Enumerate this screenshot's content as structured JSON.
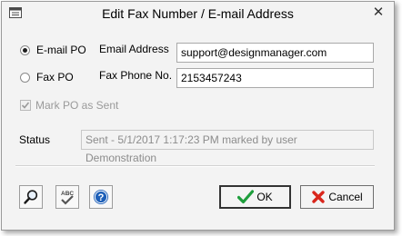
{
  "window": {
    "title": "Edit Fax Number / E-mail Address",
    "close_glyph": "✕"
  },
  "send_method": {
    "options": [
      {
        "label": "E-mail PO",
        "checked": true
      },
      {
        "label": "Fax PO",
        "checked": false
      }
    ]
  },
  "fields": {
    "email_label": "Email Address",
    "email_value": "support@designmanager.com",
    "fax_label": "Fax Phone No.",
    "fax_value": "2153457243"
  },
  "mark_sent": {
    "label": "Mark PO as Sent",
    "checked": true,
    "enabled": false
  },
  "status": {
    "label": "Status",
    "value": "Sent - 5/1/2017 1:17:23 PM marked by user Demonstration"
  },
  "toolbar": {
    "zoom_icon": "magnifier-icon",
    "spellcheck_icon": "spellcheck-icon",
    "help_icon": "help-icon",
    "help_glyph": "?"
  },
  "buttons": {
    "ok_label": "OK",
    "cancel_label": "Cancel"
  },
  "colors": {
    "ok_check": "#1e9e3c",
    "cancel_x": "#d9261c",
    "help_circle": "#1d5fb8"
  }
}
